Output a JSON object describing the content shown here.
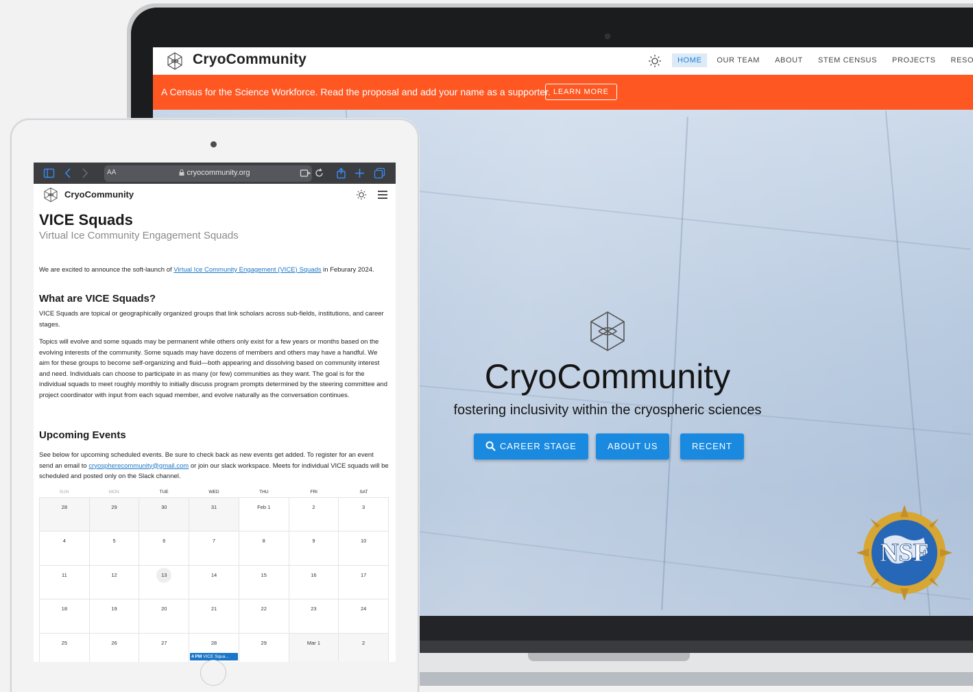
{
  "laptop": {
    "site": {
      "brand": "CryoCommunity",
      "nav": [
        {
          "label": "HOME",
          "active": true
        },
        {
          "label": "OUR TEAM",
          "active": false
        },
        {
          "label": "ABOUT",
          "active": false
        },
        {
          "label": "STEM CENSUS",
          "active": false
        },
        {
          "label": "PROJECTS",
          "active": false
        },
        {
          "label": "RESOU",
          "active": false
        }
      ],
      "banner": {
        "text": "A Census for the Science Workforce. Read the proposal and add your name as a supporter.",
        "button": "LEARN MORE"
      },
      "hero": {
        "title": "CryoCommunity",
        "subtitle": "fostering inclusivity within the cryospheric sciences",
        "buttons": [
          "CAREER STAGE",
          "ABOUT US",
          "RECENT"
        ]
      },
      "seal_label": "NSF"
    }
  },
  "tablet": {
    "browser": {
      "aa": "AA",
      "url": "cryocommunity.org"
    },
    "site": {
      "brand": "CryoCommunity",
      "heading": "VICE Squads",
      "subheading": "Virtual Ice Community Engagement Squads",
      "intro_pre": "We are excited to announce the soft-launch of ",
      "intro_link": "Virtual Ice Community Engagement (VICE) Squads",
      "intro_post": " in Feburary 2024.",
      "section1_title": "What are VICE Squads?",
      "section1_p1": "VICE Squads are topical or geographically organized groups that link scholars across sub-fields, institutions, and career stages.",
      "section1_p2": "Topics will evolve and some squads may be permanent while others only exist for a few years or months based on the evolving interests of the community. Some squads may have dozens of members and others may have a handful. We aim for these groups to become self-organizing and fluid—both appearing and dissolving based on community interest and need. Individuals can choose to participate in as many (or few) communities as they want. The goal is for the individual squads to meet roughly monthly to initially discuss program prompts determined by the steering committee and project coordinator with input from each squad member, and evolve naturally as the conversation continues.",
      "section2_title": "Upcoming Events",
      "section2_pre": "See below for upcoming scheduled events. Be sure to check back as new events get added. To register for an event send an email to ",
      "section2_link": "cryospherecommunity@gmail.com",
      "section2_post": " or join our slack workspace. Meets for individual VICE squads will be scheduled and posted only on the Slack channel.",
      "calendar": {
        "weekdays": [
          "SUN",
          "MON",
          "TUE",
          "WED",
          "THU",
          "FRI",
          "SAT"
        ],
        "weeks": [
          [
            "28",
            "29",
            "30",
            "31",
            "Feb 1",
            "2",
            "3"
          ],
          [
            "4",
            "5",
            "6",
            "7",
            "8",
            "9",
            "10"
          ],
          [
            "11",
            "12",
            "13",
            "14",
            "15",
            "16",
            "17"
          ],
          [
            "18",
            "19",
            "20",
            "21",
            "22",
            "23",
            "24"
          ],
          [
            "25",
            "26",
            "27",
            "28",
            "29",
            "Mar 1",
            "2"
          ]
        ],
        "today": "13",
        "event": {
          "day": "28",
          "time": "4 PM",
          "title": "VICE Squa..."
        }
      }
    }
  },
  "colors": {
    "accent_blue": "#1a8ae0",
    "banner_orange": "#ff5722",
    "nav_active_bg": "#dce9f7",
    "link_blue": "#1a76c8"
  },
  "icons": [
    "cryo-logo-icon",
    "sun-icon",
    "search-icon",
    "menu-icon",
    "sidebar-icon",
    "back-icon",
    "forward-icon",
    "lock-icon",
    "reader-icon",
    "reload-icon",
    "share-icon",
    "plus-icon",
    "tabs-icon"
  ]
}
